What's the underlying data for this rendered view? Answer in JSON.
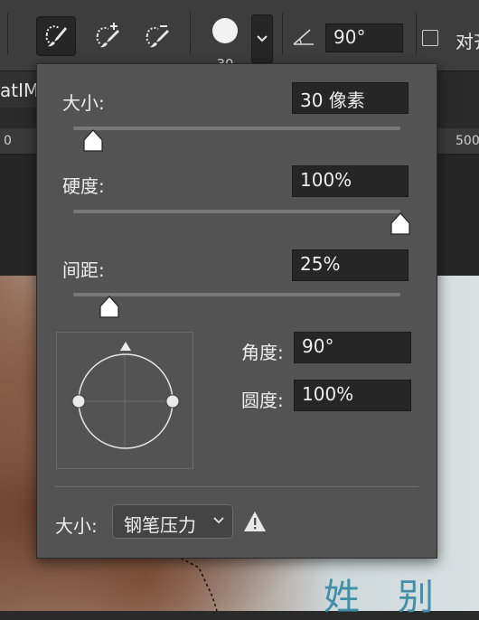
{
  "options_bar": {
    "tools": [
      {
        "icon": "brush-select-icon",
        "active": true
      },
      {
        "icon": "brush-add-icon",
        "active": false
      },
      {
        "icon": "brush-subtract-icon",
        "active": false
      }
    ],
    "brush_size": "30",
    "angle_value": "90°",
    "align_label": "对齐"
  },
  "background": {
    "doc_tab_label": "atIM",
    "ruler_labels": [
      "0",
      "500"
    ],
    "canvas_text": [
      "姓",
      "别"
    ]
  },
  "brush_panel": {
    "size": {
      "label": "大小:",
      "value": "30 像素",
      "level_percent": 6
    },
    "hardness": {
      "label": "硬度:",
      "value": "100%",
      "level_percent": 100
    },
    "spacing": {
      "label": "间距:",
      "value": "25%",
      "level_percent": 11
    },
    "angle": {
      "label": "角度:",
      "value": "90°"
    },
    "roundness": {
      "label": "圆度:",
      "value": "100%"
    },
    "pen_control": {
      "label": "大小:",
      "selected": "钢笔压力"
    },
    "warning_icon": "warning-icon",
    "colors": {
      "panel_bg": "#535353",
      "field_bg": "#262626",
      "thumb": "#ffffff"
    }
  }
}
